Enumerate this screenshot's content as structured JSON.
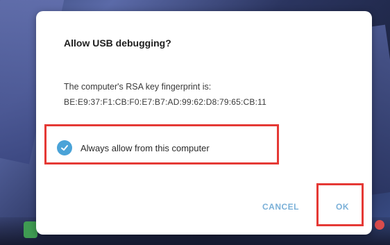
{
  "dialog": {
    "title": "Allow USB debugging?",
    "message_line1": "The computer's RSA key fingerprint is:",
    "fingerprint": "BE:E9:37:F1:CB:F0:E7:B7:AD:99:62:D8:79:65:CB:11",
    "checkbox_label": "Always allow from this computer",
    "checkbox_checked": true,
    "cancel_label": "CANCEL",
    "ok_label": "OK"
  },
  "colors": {
    "accent": "#4aa3d8",
    "button_text": "#7ab0d8",
    "highlight": "#e53935"
  },
  "icons": {
    "checkbox": "checkmark-icon"
  }
}
